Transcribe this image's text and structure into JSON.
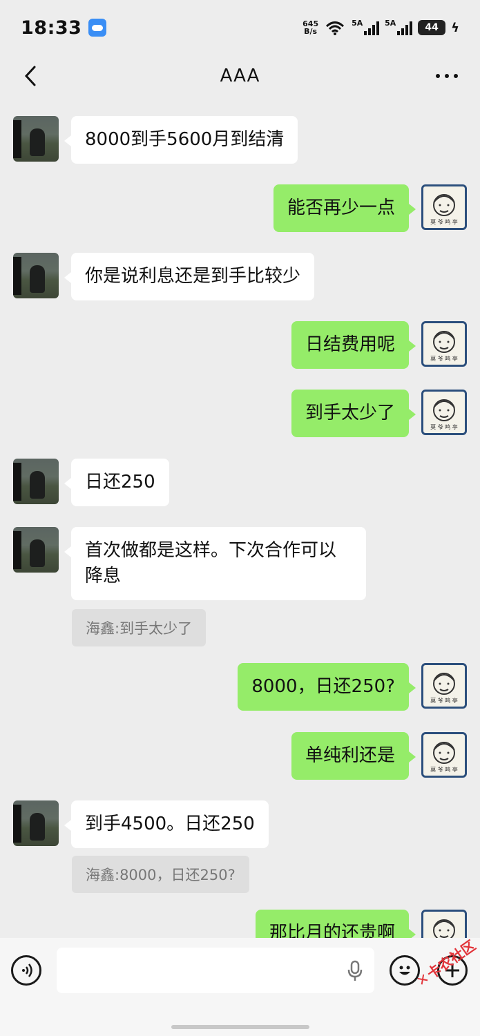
{
  "status_bar": {
    "time": "18:33",
    "net_speed_value": "645",
    "net_speed_unit": "B/s",
    "wifi_label": "6",
    "signal1_label": "5A",
    "signal2_label": "5A",
    "battery": "44"
  },
  "header": {
    "title": "AAA"
  },
  "messages": [
    {
      "side": "in",
      "text": "8000到手5600月到结清"
    },
    {
      "side": "out",
      "text": "能否再少一点"
    },
    {
      "side": "in",
      "text": "你是说利息还是到手比较少"
    },
    {
      "side": "out",
      "text": "日结费用呢"
    },
    {
      "side": "out",
      "text": "到手太少了"
    },
    {
      "side": "in",
      "text": "日还250"
    },
    {
      "side": "in",
      "text": "首次做都是这样。下次合作可以降息",
      "quote": "海鑫:到手太少了"
    },
    {
      "side": "out",
      "text": "8000，日还250?"
    },
    {
      "side": "out",
      "text": "单纯利还是"
    },
    {
      "side": "in",
      "text": "到手4500。日还250",
      "quote": "海鑫:8000，日还250?"
    },
    {
      "side": "out",
      "text": "那比月的还贵啊"
    }
  ],
  "avatar_right_seal": "莫 爷 鸣 亭",
  "input": {
    "placeholder": ""
  },
  "watermark": "卡农社区",
  "colors": {
    "outgoing_bubble": "#95ec69",
    "incoming_bubble": "#ffffff",
    "background": "#ededed"
  },
  "icons": [
    "back-arrow-icon",
    "more-icon",
    "voice-icon",
    "mic-icon",
    "emoji-icon",
    "plus-icon",
    "wifi-icon",
    "battery-icon"
  ]
}
